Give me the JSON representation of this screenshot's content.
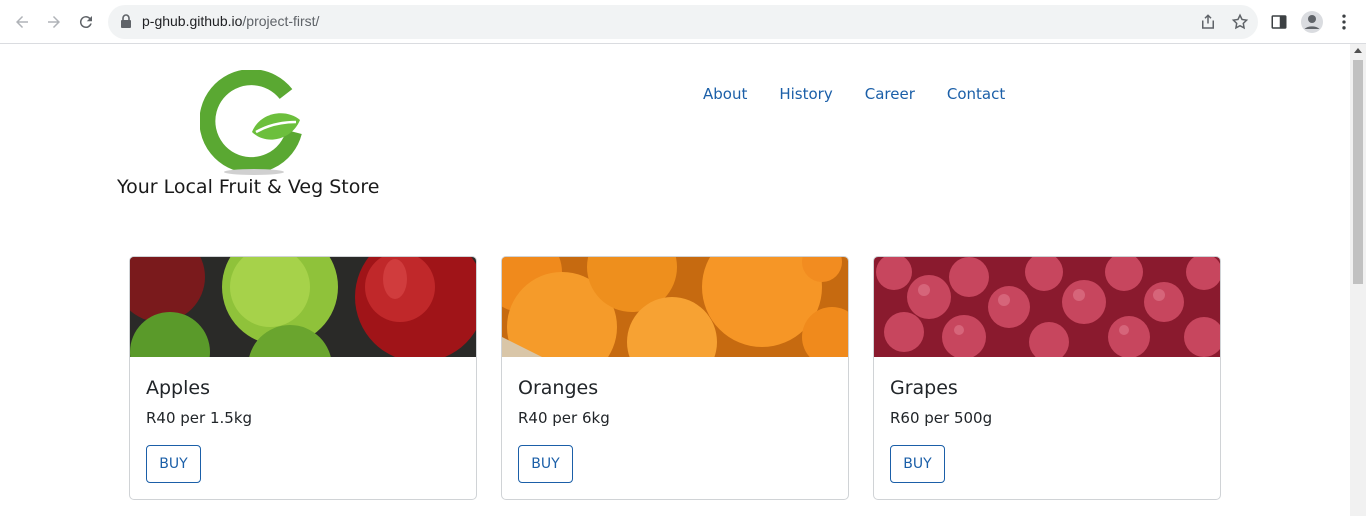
{
  "browser": {
    "url_host": "p-ghub.github.io",
    "url_path": "/project-first/"
  },
  "site": {
    "tagline": "Your Local Fruit & Veg Store",
    "nav": [
      {
        "label": "About"
      },
      {
        "label": "History"
      },
      {
        "label": "Career"
      },
      {
        "label": "Contact"
      }
    ]
  },
  "products": [
    {
      "name": "Apples",
      "price": "R40 per 1.5kg",
      "button": "BUY"
    },
    {
      "name": "Oranges",
      "price": "R40 per 6kg",
      "button": "BUY"
    },
    {
      "name": "Grapes",
      "price": "R60 per 500g",
      "button": "BUY"
    }
  ],
  "colors": {
    "link": "#1b5fa8",
    "logo_green": "#5aa832",
    "chrome_bg": "#f1f3f4"
  },
  "icons": [
    "back-icon",
    "forward-icon",
    "reload-icon",
    "lock-icon",
    "share-icon",
    "star-icon",
    "side-panel-icon",
    "profile-icon",
    "menu-icon"
  ]
}
